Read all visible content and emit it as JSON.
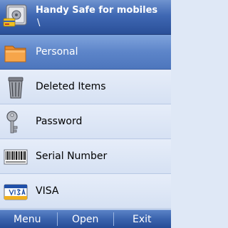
{
  "header": {
    "title": "Handy Safe for mobiles",
    "path": "\\",
    "icon": "safe-icon"
  },
  "list": {
    "items": [
      {
        "label": "Personal",
        "icon": "folder-icon",
        "selected": true
      },
      {
        "label": "Deleted Items",
        "icon": "trash-icon",
        "selected": false
      },
      {
        "label": "Password",
        "icon": "key-icon",
        "selected": false
      },
      {
        "label": "Serial Number",
        "icon": "barcode-icon",
        "selected": false
      },
      {
        "label": "VISA",
        "icon": "credit-card-icon",
        "selected": false
      }
    ]
  },
  "softkeys": {
    "left": "Menu",
    "center": "Open",
    "right": "Exit"
  },
  "colors": {
    "titlebar": "#3f68b3",
    "selected_row": "#5d85c9",
    "row": "#dfe8f6",
    "softbar": "#3a63ad"
  }
}
